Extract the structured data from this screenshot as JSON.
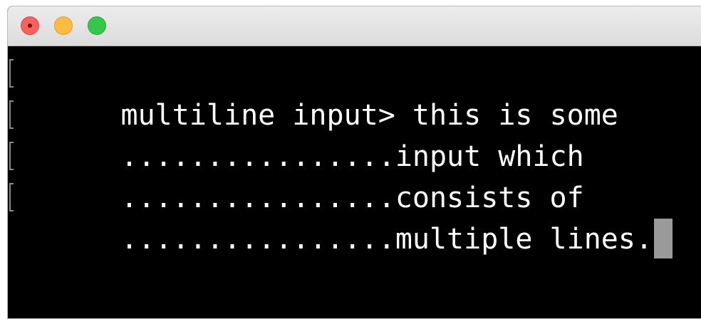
{
  "window": {
    "controls": {
      "close": "close-button",
      "minimize": "minimize-button",
      "zoom": "zoom-button"
    }
  },
  "terminal": {
    "lines": [
      {
        "prefix": "multiline input> ",
        "text": "this is some"
      },
      {
        "prefix": "................",
        "text": "input which"
      },
      {
        "prefix": "................",
        "text": "consists of"
      },
      {
        "prefix": "................",
        "text": "multiple lines."
      }
    ],
    "cursor_color": "#9a9a9a",
    "background_color": "#000000",
    "text_color": "#ffffff"
  }
}
